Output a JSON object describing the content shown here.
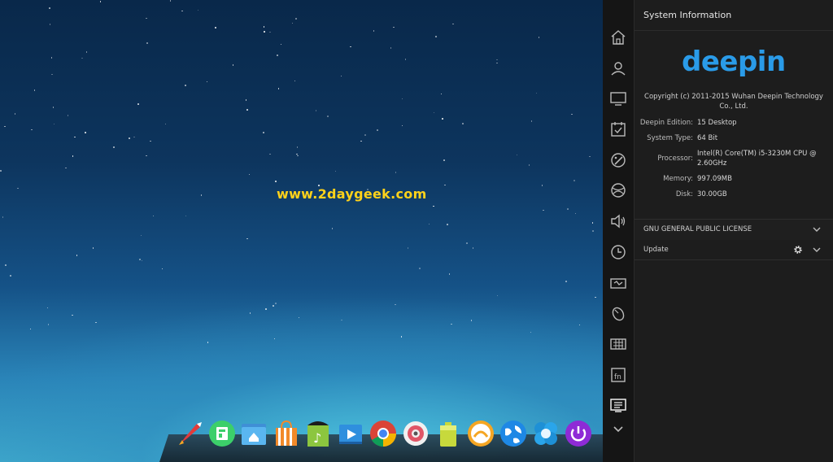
{
  "desktop": {
    "watermark": "www.2daygeek.com"
  },
  "dock": {
    "items": [
      {
        "name": "launcher-rocket-icon",
        "color": "#e23b3b"
      },
      {
        "name": "software-center-icon",
        "color": "#3ccf6a"
      },
      {
        "name": "file-manager-icon",
        "color": "#4aa8e8"
      },
      {
        "name": "store-bag-icon",
        "color": "#f28a2a"
      },
      {
        "name": "music-player-icon",
        "color": "#8cc63f"
      },
      {
        "name": "video-player-icon",
        "color": "#2f8fde"
      },
      {
        "name": "chrome-browser-icon",
        "color": "#db4437"
      },
      {
        "name": "settings-icon",
        "color": "#e05566"
      },
      {
        "name": "battery-icon",
        "color": "#c7d93c"
      },
      {
        "name": "screenshot-icon",
        "color": "#f5a623"
      },
      {
        "name": "network-globe-icon",
        "color": "#1e88e5"
      },
      {
        "name": "deepin-flower-icon",
        "color": "#1e90d6"
      },
      {
        "name": "power-icon",
        "color": "#8e2bd6"
      }
    ]
  },
  "nav": {
    "items": [
      "home-icon",
      "user-accounts-icon",
      "display-icon",
      "default-apps-icon",
      "personalization-icon",
      "network-icon",
      "sound-icon",
      "time-date-icon",
      "power-management-icon",
      "mouse-icon",
      "keyboard-icon",
      "fn-keys-icon",
      "system-info-icon",
      "more-chevron-down-icon"
    ]
  },
  "panel": {
    "title": "System Information",
    "logo": "deepin",
    "copyright": "Copyright (c) 2011-2015 Wuhan Deepin Technology Co., Ltd.",
    "info": [
      {
        "key": "Deepin Edition:",
        "value": "15 Desktop"
      },
      {
        "key": "System Type:",
        "value": "64 Bit"
      },
      {
        "key": "Processor:",
        "value": "Intel(R) Core(TM) i5-3230M CPU @ 2.60GHz"
      },
      {
        "key": "Memory:",
        "value": "997.09MB"
      },
      {
        "key": "Disk:",
        "value": "30.00GB"
      }
    ],
    "license_label": "GNU GENERAL PUBLIC LICENSE",
    "update_label": "Update"
  },
  "colors": {
    "accent": "#2a9be8",
    "watermark": "#ffd21a"
  }
}
